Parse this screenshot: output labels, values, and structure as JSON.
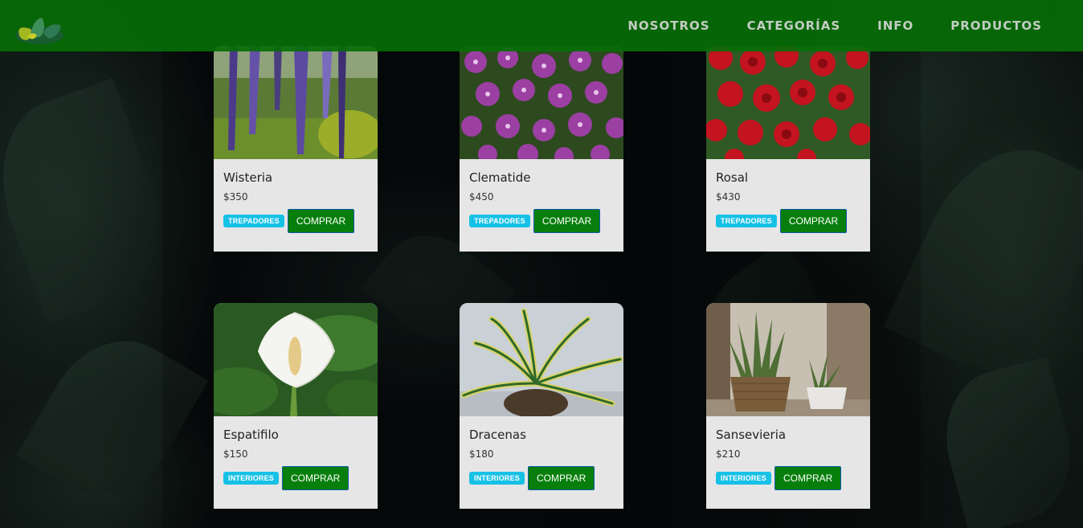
{
  "nav": {
    "items": [
      "NOSOTROS",
      "CATEGORÍAS",
      "INFO",
      "PRODUCTOS"
    ]
  },
  "products": [
    {
      "name": "Wisteria",
      "price": "$350",
      "category": "TREPADORES",
      "button": "COMPRAR",
      "image": "wisteria-flowers"
    },
    {
      "name": "Clematide",
      "price": "$450",
      "category": "TREPADORES",
      "button": "COMPRAR",
      "image": "clematis-flowers"
    },
    {
      "name": "Rosal",
      "price": "$430",
      "category": "TREPADORES",
      "button": "COMPRAR",
      "image": "red-roses"
    },
    {
      "name": "Espatifilo",
      "price": "$150",
      "category": "INTERIORES",
      "button": "COMPRAR",
      "image": "peace-lily"
    },
    {
      "name": "Dracenas",
      "price": "$180",
      "category": "INTERIORES",
      "button": "COMPRAR",
      "image": "dracaena-plant"
    },
    {
      "name": "Sansevieria",
      "price": "$210",
      "category": "INTERIORES",
      "button": "COMPRAR",
      "image": "snake-plant-pots"
    }
  ],
  "colors": {
    "navbar": "#066e06",
    "badge": "#17c1e6",
    "button": "#087f0c",
    "card": "#e6e6e6"
  }
}
